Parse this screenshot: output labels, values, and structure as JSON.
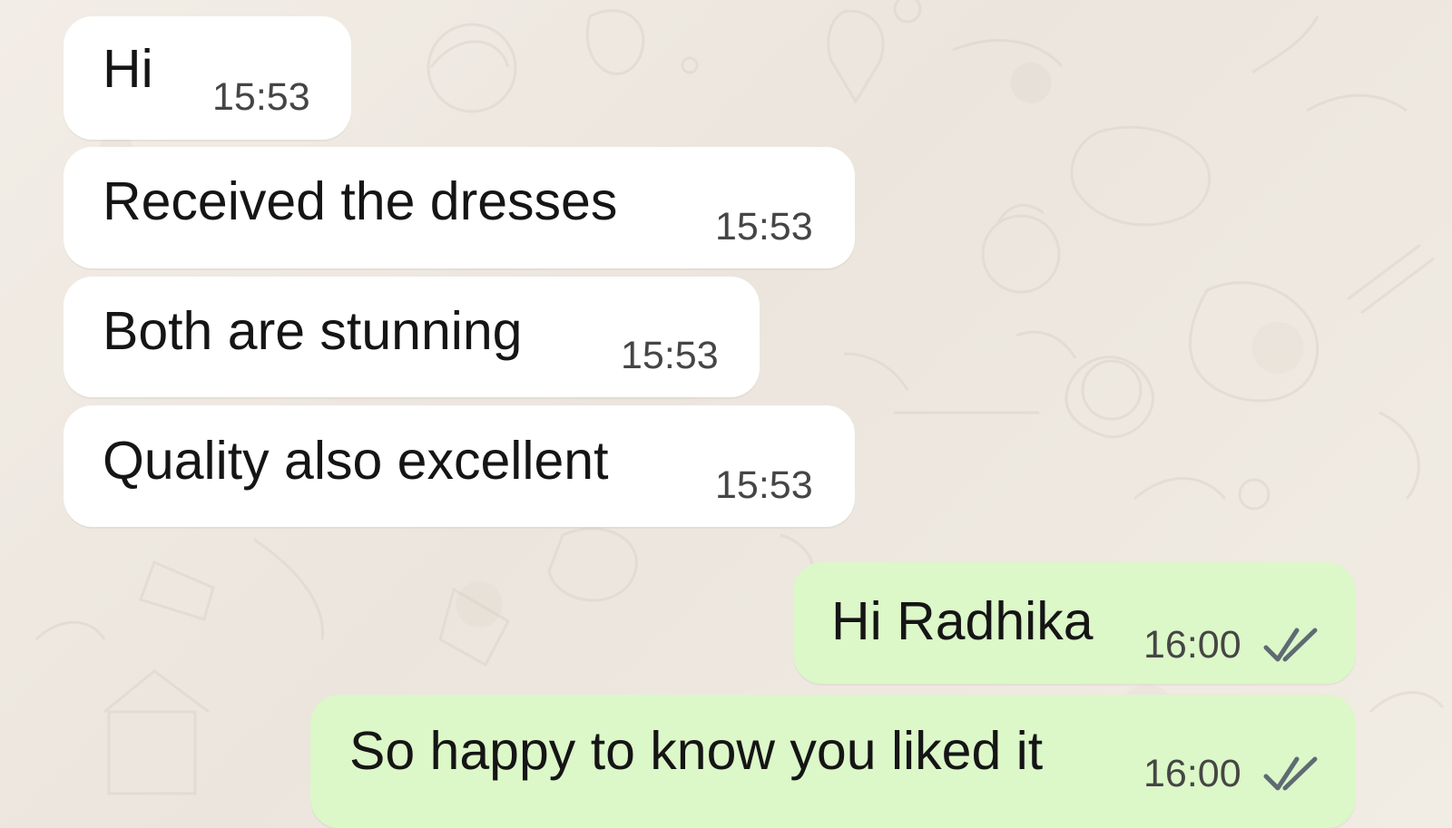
{
  "messages": [
    {
      "direction": "incoming",
      "text": "Hi",
      "time": "15:53"
    },
    {
      "direction": "incoming",
      "text": "Received the dresses",
      "time": "15:53"
    },
    {
      "direction": "incoming",
      "text": "Both are stunning",
      "time": "15:53"
    },
    {
      "direction": "incoming",
      "text": "Quality also excellent",
      "time": "15:53"
    },
    {
      "direction": "outgoing",
      "text": "Hi Radhika",
      "time": "16:00",
      "status_icon": "double-check-icon"
    },
    {
      "direction": "outgoing",
      "text": "So happy to know you liked it",
      "time": "16:00",
      "status_icon": "double-check-icon"
    }
  ],
  "colors": {
    "background": "#efe9e1",
    "incoming_bubble": "#ffffff",
    "outgoing_bubble": "#dcf7c8",
    "message_text": "#151515",
    "time_text": "#454545",
    "check_icon": "#5f6b73"
  }
}
